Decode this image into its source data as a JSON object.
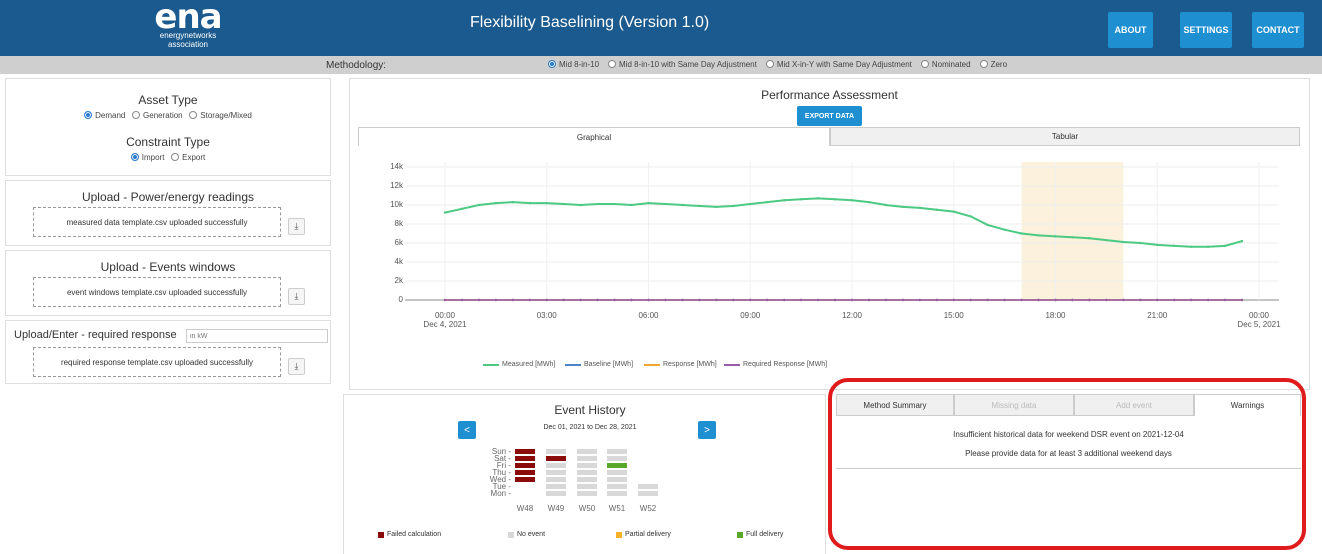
{
  "header": {
    "logo_main": "ena",
    "logo_sub1": "energynetworks",
    "logo_sub2": "association",
    "title": "Flexibility Baselining (Version 1.0)",
    "buttons": [
      "ABOUT",
      "SETTINGS",
      "CONTACT"
    ]
  },
  "methodology": {
    "label": "Methodology:",
    "options": [
      "Mid 8-in-10",
      "Mid 8-in-10 with Same Day Adjustment",
      "Mid X-in-Y with Same Day Adjustment",
      "Nominated",
      "Zero"
    ],
    "selected": "Mid 8-in-10"
  },
  "asset_type": {
    "title": "Asset Type",
    "options": [
      "Demand",
      "Generation",
      "Storage/Mixed"
    ],
    "selected": "Demand"
  },
  "constraint_type": {
    "title": "Constraint Type",
    "options": [
      "Import",
      "Export"
    ],
    "selected": "Import"
  },
  "upload_power": {
    "title": "Upload - Power/energy readings",
    "status": "measured data template.csv uploaded successfully"
  },
  "upload_events": {
    "title": "Upload - Events windows",
    "status": "event windows template.csv uploaded successfully"
  },
  "upload_response": {
    "title": "Upload/Enter - required response",
    "input_placeholder": "in kW",
    "status": "required response template.csv uploaded successfully"
  },
  "performance": {
    "title": "Performance Assessment",
    "export_label": "EXPORT DATA",
    "tabs": [
      "Graphical",
      "Tabular"
    ],
    "active_tab": "Graphical"
  },
  "chart_data": {
    "type": "line",
    "title": "",
    "xlabel": "",
    "ylabel": "",
    "y_ticks": [
      "0",
      "2k",
      "4k",
      "6k",
      "8k",
      "10k",
      "12k",
      "14k"
    ],
    "x_ticks": [
      "00:00\nDec 4, 2021",
      "03:00",
      "06:00",
      "09:00",
      "12:00",
      "15:00",
      "18:00",
      "21:00",
      "00:00\nDec 5, 2021"
    ],
    "ylim": [
      0,
      14000
    ],
    "x_hours": [
      0,
      0.5,
      1,
      1.5,
      2,
      2.5,
      3,
      3.5,
      4,
      4.5,
      5,
      5.5,
      6,
      6.5,
      7,
      7.5,
      8,
      8.5,
      9,
      9.5,
      10,
      10.5,
      11,
      11.5,
      12,
      12.5,
      13,
      13.5,
      14,
      14.5,
      15,
      15.5,
      16,
      16.5,
      17,
      17.5,
      18,
      18.5,
      19,
      19.5,
      20,
      20.5,
      21,
      21.5,
      22,
      22.5,
      23,
      23.5
    ],
    "event_window_hours": [
      17,
      20
    ],
    "event_window_color": "#fbf1dc",
    "series": [
      {
        "name": "Measured [MWh]",
        "color": "#4cc982",
        "values": [
          9200,
          9600,
          10000,
          10200,
          10300,
          10200,
          10200,
          10100,
          10000,
          10100,
          10100,
          10000,
          10200,
          10100,
          10000,
          9900,
          9800,
          9900,
          10100,
          10300,
          10500,
          10600,
          10700,
          10600,
          10500,
          10300,
          10000,
          9800,
          9700,
          9500,
          9300,
          8800,
          7900,
          7400,
          7000,
          6800,
          6700,
          6600,
          6500,
          6300,
          6100,
          6000,
          5800,
          5700,
          5600,
          5600,
          5700,
          6200
        ]
      },
      {
        "name": "Baseline [MWh]",
        "color": "#4a86c6",
        "values": [
          0
        ]
      },
      {
        "name": "Response [MWh]",
        "color": "#f0a830",
        "values": [
          0
        ]
      },
      {
        "name": "Required Response [MWh]",
        "color": "#9a5aa8",
        "values": [
          0
        ]
      }
    ]
  },
  "event_history": {
    "title": "Event History",
    "range": "Dec 01, 2021 to Dec 28, 2021",
    "prev": "<",
    "next": ">",
    "days": [
      "Sun -",
      "Sat -",
      "Fri -",
      "Thu -",
      "Wed -",
      "Tue -",
      "Mon -"
    ],
    "weeks": [
      "W48",
      "W49",
      "W50",
      "W51",
      "W52"
    ],
    "legend": [
      "Failed calculation",
      "No event",
      "Partial delivery",
      "Full delivery"
    ],
    "colors": {
      "failed": "#8b0a0a",
      "none": "#d8d8d8",
      "partial": "#f6b32a",
      "full": "#5aa82a"
    }
  },
  "info_panel": {
    "tabs": [
      "Method Summary",
      "Missing data",
      "Add event",
      "Warnings"
    ],
    "active_tab": "Warnings",
    "warning_line1": "Insufficient historical data for weekend DSR event on 2021-12-04",
    "warning_line2": "Please provide data for at least 3 additional weekend days"
  },
  "highlight_color": "#e01b1b"
}
